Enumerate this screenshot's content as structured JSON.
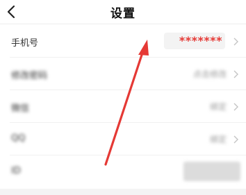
{
  "header": {
    "title": "设置",
    "back_icon": "chevron-left-icon"
  },
  "rows": [
    {
      "label": "手机号",
      "value": "*******"
    },
    {
      "label": "修改密码",
      "value": "点击修改"
    },
    {
      "label": "微信",
      "value": "绑定"
    },
    {
      "label": "QQ",
      "value": "绑定"
    },
    {
      "label": "ID",
      "value": ""
    }
  ],
  "colors": {
    "annotation_arrow": "#e53935",
    "phone_value": "#e53935"
  }
}
